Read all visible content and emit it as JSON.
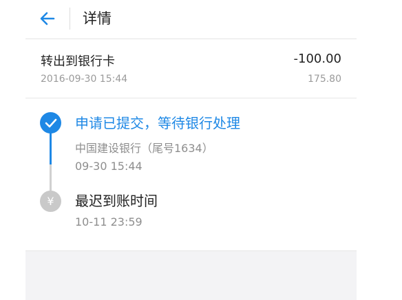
{
  "header": {
    "title": "详情",
    "back_icon": "arrow-left-icon",
    "accent": "#1e88e5"
  },
  "summary": {
    "title": "转出到银行卡",
    "amount": "-100.00",
    "date": "2016-09-30 15:44",
    "balance": "175.80"
  },
  "timeline": {
    "steps": [
      {
        "title": "申请已提交，等待银行处理",
        "detail": "中国建设银行（尾号1634）",
        "time": "09-30 15:44",
        "status": "done",
        "icon": "check-icon"
      },
      {
        "title": "最迟到账时间",
        "time": "10-11 23:59",
        "status": "pending",
        "icon": "yuan-icon",
        "icon_glyph": "¥"
      }
    ],
    "done_color": "#1e88e5",
    "pending_color": "#c9c9c9"
  }
}
